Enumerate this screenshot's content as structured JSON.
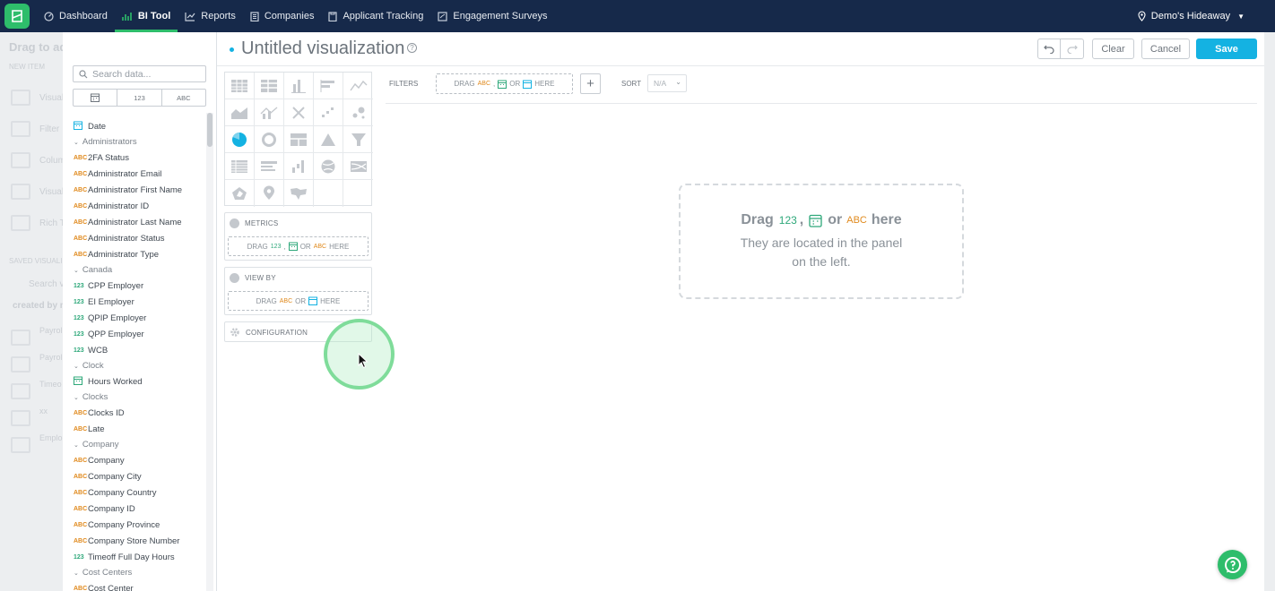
{
  "nav": {
    "items": [
      {
        "label": "Dashboard",
        "icon": "dashboard-icon"
      },
      {
        "label": "BI Tool",
        "icon": "chart-icon",
        "active": true
      },
      {
        "label": "Reports",
        "icon": "reports-icon"
      },
      {
        "label": "Companies",
        "icon": "building-icon"
      },
      {
        "label": "Applicant Tracking",
        "icon": "briefcase-icon"
      },
      {
        "label": "Engagement Surveys",
        "icon": "survey-icon"
      }
    ],
    "location": "Demo's Hideaway"
  },
  "background": {
    "title": "Drag to ad",
    "new_item": "NEW ITEM",
    "items": [
      "Visuali",
      "Filter",
      "Colum",
      "Visuali",
      "Rich Te"
    ],
    "saved": "SAVED VISUALI",
    "search": "Search vi",
    "created_by": "created by m",
    "list": [
      "Payrol",
      "Payrol",
      "Timeo",
      "xx",
      "Emplo"
    ]
  },
  "data_panel": {
    "search_placeholder": "Search data...",
    "type_filters": [
      "date",
      "123",
      "ABC"
    ],
    "fields": [
      {
        "kind": "date",
        "label": "Date"
      },
      {
        "kind": "group",
        "label": "Administrators"
      },
      {
        "kind": "abc",
        "label": "2FA Status"
      },
      {
        "kind": "abc",
        "label": "Administrator Email"
      },
      {
        "kind": "abc",
        "label": "Administrator First Name"
      },
      {
        "kind": "abc",
        "label": "Administrator ID"
      },
      {
        "kind": "abc",
        "label": "Administrator Last Name"
      },
      {
        "kind": "abc",
        "label": "Administrator Status"
      },
      {
        "kind": "abc",
        "label": "Administrator Type"
      },
      {
        "kind": "group",
        "label": "Canada"
      },
      {
        "kind": "num",
        "label": "CPP Employer"
      },
      {
        "kind": "num",
        "label": "EI Employer"
      },
      {
        "kind": "num",
        "label": "QPIP Employer"
      },
      {
        "kind": "num",
        "label": "QPP Employer"
      },
      {
        "kind": "num",
        "label": "WCB"
      },
      {
        "kind": "group",
        "label": "Clock"
      },
      {
        "kind": "date",
        "label": "Hours Worked"
      },
      {
        "kind": "group",
        "label": "Clocks"
      },
      {
        "kind": "abc",
        "label": "Clocks ID"
      },
      {
        "kind": "abc",
        "label": "Late"
      },
      {
        "kind": "group",
        "label": "Company"
      },
      {
        "kind": "abc",
        "label": "Company"
      },
      {
        "kind": "abc",
        "label": "Company City"
      },
      {
        "kind": "abc",
        "label": "Company Country"
      },
      {
        "kind": "abc",
        "label": "Company ID"
      },
      {
        "kind": "abc",
        "label": "Company Province"
      },
      {
        "kind": "abc",
        "label": "Company Store Number"
      },
      {
        "kind": "num",
        "label": "Timeoff Full Day Hours"
      },
      {
        "kind": "group",
        "label": "Cost Centers"
      },
      {
        "kind": "abc",
        "label": "Cost Center"
      }
    ]
  },
  "header": {
    "title": "Untitled visualization",
    "clear": "Clear",
    "cancel": "Cancel",
    "save": "Save"
  },
  "sections": {
    "metrics": "METRICS",
    "metrics_drop": [
      "DRAG",
      "123",
      ",",
      "OR",
      "ABC",
      "HERE"
    ],
    "view_by": "VIEW BY",
    "view_by_drop": [
      "DRAG",
      "ABC",
      "OR",
      "HERE"
    ],
    "configuration": "CONFIGURATION"
  },
  "filters": {
    "label": "FILTERS",
    "drop": [
      "DRAG",
      "ABC",
      ",",
      "OR",
      "HERE"
    ],
    "sort_label": "SORT",
    "sort_value": "N/A"
  },
  "canvas": {
    "drag": "Drag",
    "num": "123",
    "comma": ",",
    "or": "or",
    "abc": "ABC",
    "here": "here",
    "hint": "They are located in the panel on the left."
  },
  "colors": {
    "nav_bg": "#16294a",
    "accent_green": "#2ebd6b",
    "save_blue": "#14b2e2",
    "attribute_orange": "#e08a1e",
    "measure_green": "#2ea87a"
  }
}
